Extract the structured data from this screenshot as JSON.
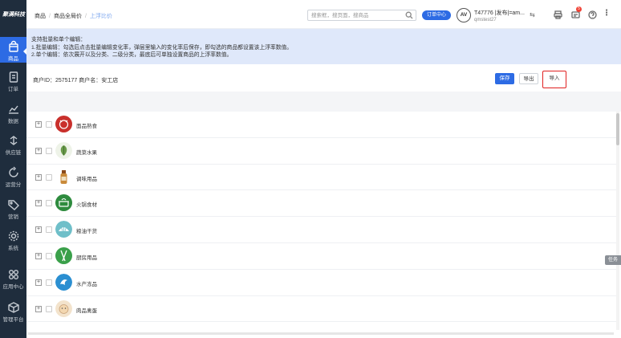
{
  "sidebar": {
    "logo": "聚满科技",
    "items": [
      {
        "label": "商品",
        "icon": "bag-icon"
      },
      {
        "label": "订单",
        "icon": "document-icon"
      },
      {
        "label": "数据",
        "icon": "chart-icon"
      },
      {
        "label": "供应链",
        "icon": "share-icon"
      },
      {
        "label": "营销",
        "icon": "tag-icon"
      },
      {
        "label": "运营分",
        "icon": "refresh-icon"
      },
      {
        "label": "系统",
        "icon": "gear-icon"
      },
      {
        "label": "应用中心",
        "icon": "apps-icon"
      },
      {
        "label": "管理平台",
        "icon": "cube-icon"
      }
    ]
  },
  "header": {
    "breadcrumb": [
      "商品",
      "商品全局价",
      "上浮比价"
    ],
    "search_placeholder": "搜索框，搜页面，搜商品",
    "tag_button": "订单中心",
    "avatar": "AV",
    "user_line1": "T47776 |发布|=am...",
    "user_line2": "qmstest27",
    "swap": "⇆",
    "notification_count": "5"
  },
  "notice": {
    "line1": "支持批量和单个编辑：",
    "line2": "1.批量编辑：勾选后点击批量编辑变化率，弹层里输入的变化率后保存，即勾选的商品都设置该上浮率数值。",
    "line3": "2.单个编辑：依次展开以及分类、二级分类，最底后可单独设置商品的上浮率数值。"
  },
  "info": {
    "text": "商户ID：2575177   商户名：安工店",
    "save": "保存",
    "export": "导出",
    "import": "导入"
  },
  "categories": [
    {
      "name": "面品熟食",
      "icon_color": "#c9302c"
    },
    {
      "name": "蔬菜水果",
      "icon_color": "#6a9a4a"
    },
    {
      "name": "调味用品",
      "icon_color": "#c98a3a"
    },
    {
      "name": "火锅食材",
      "icon_color": "#2e8b3e"
    },
    {
      "name": "粮油干货",
      "icon_color": "#6fbfc9"
    },
    {
      "name": "厨房用品",
      "icon_color": "#3aa04a"
    },
    {
      "name": "水产冻品",
      "icon_color": "#2b8fd1"
    },
    {
      "name": "肉品禽蛋",
      "icon_color": "#f3d7b0"
    }
  ],
  "float_tab": "任务"
}
